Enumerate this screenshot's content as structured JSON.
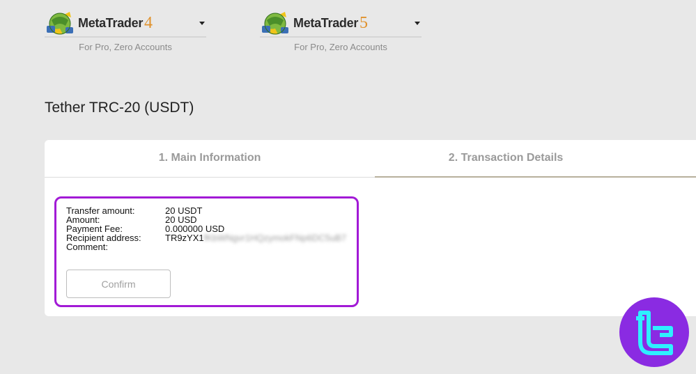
{
  "platforms": [
    {
      "name": "MetaTrader",
      "version": "4",
      "subtitle": "For Pro, Zero Accounts"
    },
    {
      "name": "MetaTrader",
      "version": "5",
      "subtitle": "For Pro, Zero Accounts"
    }
  ],
  "page_title": "Tether TRC-20 (USDT)",
  "tabs": [
    {
      "label": "1. Main Information"
    },
    {
      "label": "2. Transaction Details"
    }
  ],
  "details": {
    "rows": [
      {
        "label": "Transfer amount:",
        "value": "20 USDT"
      },
      {
        "label": "Amount:",
        "value": "20 USD"
      },
      {
        "label": "Payment Fee:",
        "value": "0.000000 USD"
      },
      {
        "label": "Recipient address:",
        "value": "TR9zYX1"
      },
      {
        "label": "Comment:",
        "value": ""
      }
    ],
    "confirm_label": "Confirm"
  },
  "colors": {
    "highlight_border": "#a21ad6",
    "badge": "#8a2be2",
    "metatrader_accent": "#e0922d"
  },
  "icons": {
    "platform_logo": "metatrader-globe-icon",
    "dropdown": "chevron-down-icon",
    "watermark": "tradingfinder-logo-icon"
  }
}
